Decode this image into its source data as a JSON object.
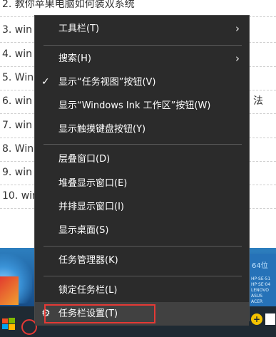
{
  "article_list": [
    {
      "label": "2. 教你苹果电脑如何装双系统",
      "tail": ""
    },
    {
      "label": "3. win",
      "tail": ""
    },
    {
      "label": "4. win",
      "tail": ""
    },
    {
      "label": "5. Win",
      "tail": ""
    },
    {
      "label": "6. win",
      "tail": "法"
    },
    {
      "label": "7. win",
      "tail": ""
    },
    {
      "label": "8. Win",
      "tail": ""
    },
    {
      "label": "9. win",
      "tail": ""
    },
    {
      "label": "10. win",
      "tail": ""
    }
  ],
  "desktop": {
    "edition_text": "64位",
    "tiny_text": "HP·SE·51\nHP·SE·04\nLENOVO\nASUS\nACER"
  },
  "context_menu": {
    "toolbars": "工具栏(T)",
    "search": "搜索(H)",
    "show_task_view": "显示“任务视图”按钮(V)",
    "show_ink": "显示“Windows Ink 工作区”按钮(W)",
    "show_touch_keyboard": "显示触摸键盘按钮(Y)",
    "cascade": "层叠窗口(D)",
    "stack": "堆叠显示窗口(E)",
    "side_by_side": "并排显示窗口(I)",
    "show_desktop": "显示桌面(S)",
    "task_manager": "任务管理器(K)",
    "lock_taskbar": "锁定任务栏(L)",
    "taskbar_settings": "任务栏设置(T)"
  },
  "icons": {
    "check": "✓",
    "submenu": "›",
    "gear": "⚙"
  },
  "colors": {
    "menu_bg": "#2b2b2b",
    "menu_hover": "#414141",
    "annotation": "#e53935"
  }
}
